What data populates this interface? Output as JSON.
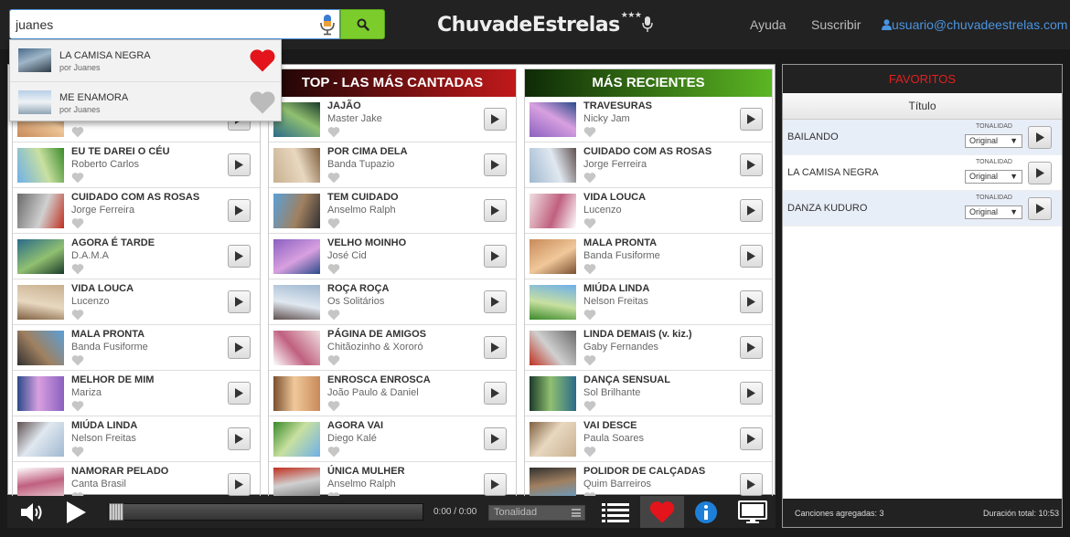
{
  "search": {
    "value": "juanes"
  },
  "logo": {
    "name": "ChuvadeEstrelas",
    "stars": "★★★"
  },
  "nav": {
    "help": "Ayuda",
    "subscribe": "Suscribir",
    "email": "usuario@chuvadeestrelas.com"
  },
  "suggestions": [
    {
      "title": "LA CAMISA NEGRA",
      "artist": "por Juanes",
      "favorite": true
    },
    {
      "title": "ME ENAMORA",
      "artist": "por Juanes",
      "favorite": false
    }
  ],
  "columns": [
    {
      "title": "",
      "songs": [
        {
          "title": "",
          "artist": ""
        },
        {
          "title": "EU TE DAREI O CÉU",
          "artist": "Roberto Carlos"
        },
        {
          "title": "CUIDADO COM AS ROSAS",
          "artist": "Jorge Ferreira"
        },
        {
          "title": "AGORA É TARDE",
          "artist": "D.A.M.A"
        },
        {
          "title": "VIDA LOUCA",
          "artist": "Lucenzo"
        },
        {
          "title": "MALA PRONTA",
          "artist": "Banda Fusiforme"
        },
        {
          "title": "MELHOR DE MIM",
          "artist": "Mariza"
        },
        {
          "title": "MIÚDA LINDA",
          "artist": "Nelson Freitas"
        },
        {
          "title": "NAMORAR PELADO",
          "artist": "Canta Brasil"
        }
      ]
    },
    {
      "title": "TOP - LAS MÁS CANTADAS",
      "songs": [
        {
          "title": "JAJÃO",
          "artist": "Master Jake"
        },
        {
          "title": "POR CIMA DELA",
          "artist": "Banda Tupazio"
        },
        {
          "title": "TEM CUIDADO",
          "artist": "Anselmo Ralph"
        },
        {
          "title": "VELHO MOINHO",
          "artist": "José Cid"
        },
        {
          "title": "ROÇA ROÇA",
          "artist": "Os Solitários"
        },
        {
          "title": "PÁGINA DE AMIGOS",
          "artist": "Chitãozinho & Xororó"
        },
        {
          "title": "ENROSCA ENROSCA",
          "artist": "João Paulo & Daniel"
        },
        {
          "title": "AGORA VAI",
          "artist": "Diego Kalé"
        },
        {
          "title": "ÚNICA MULHER",
          "artist": "Anselmo Ralph"
        }
      ]
    },
    {
      "title": "MÁS RECIENTES",
      "songs": [
        {
          "title": "TRAVESURAS",
          "artist": "Nicky Jam"
        },
        {
          "title": "CUIDADO COM AS ROSAS",
          "artist": "Jorge Ferreira"
        },
        {
          "title": "VIDA LOUCA",
          "artist": "Lucenzo"
        },
        {
          "title": "MALA PRONTA",
          "artist": "Banda Fusiforme"
        },
        {
          "title": "MIÚDA LINDA",
          "artist": "Nelson Freitas"
        },
        {
          "title": "LINDA DEMAIS (v. kiz.)",
          "artist": "Gaby Fernandes"
        },
        {
          "title": "DANÇA SENSUAL",
          "artist": "Sol Brilhante"
        },
        {
          "title": "VAI DESCE",
          "artist": "Paula Soares"
        },
        {
          "title": "POLIDOR DE CALÇADAS",
          "artist": "Quim Barreiros"
        }
      ]
    }
  ],
  "favorites": {
    "title": "FAVORITOS",
    "column_header": "Título",
    "tonality_label": "TONALIDAD",
    "items": [
      {
        "title": "BAILANDO",
        "tonality": "Original"
      },
      {
        "title": "LA CAMISA NEGRA",
        "tonality": "Original"
      },
      {
        "title": "DANZA KUDURO",
        "tonality": "Original"
      }
    ],
    "count_text": "Canciones agregadas: 3",
    "duration_text": "Duración total: 10:53"
  },
  "player": {
    "time": "0:00 / 0:00",
    "tonality_placeholder": "Tonalidad",
    "progress": 0
  },
  "colors": {
    "top_header": "#c0191b",
    "recent_header": "#3a8a1a",
    "search_button": "#7ccd2c",
    "favorite_heart": "#e3141b",
    "email_link": "#4b94e0",
    "info_icon": "#1e7fd8",
    "favorites_title": "#e02020"
  },
  "icons": {
    "mic": "microphone-icon",
    "search": "search-icon",
    "user": "user-icon",
    "heart": "heart-icon",
    "play": "play-icon",
    "volume": "volume-icon",
    "list": "list-icon",
    "info": "info-icon",
    "monitor": "monitor-icon"
  }
}
